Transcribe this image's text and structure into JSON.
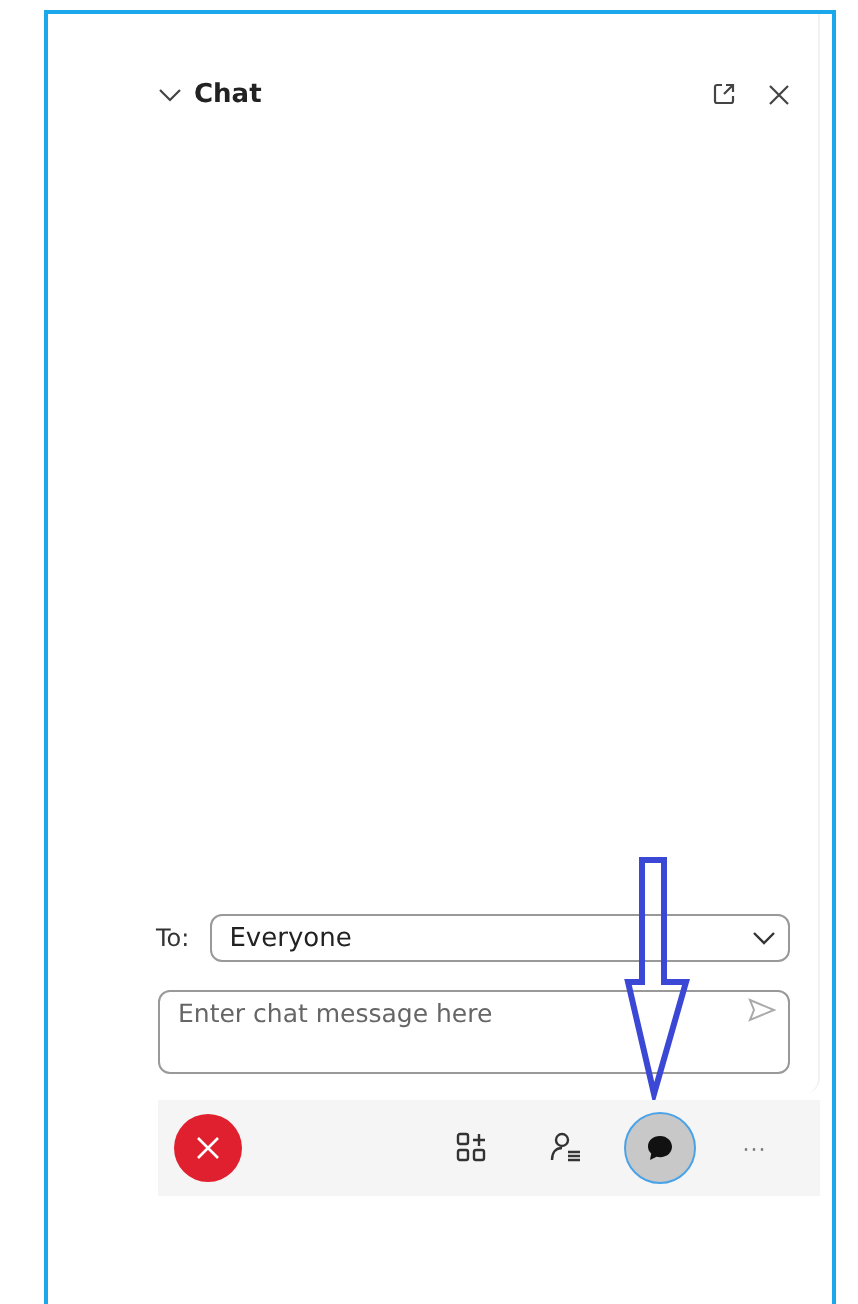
{
  "chat_panel": {
    "title": "Chat",
    "expanded": true
  },
  "recipient": {
    "label": "To:",
    "value": "Everyone"
  },
  "message": {
    "placeholder": "Enter chat message here"
  },
  "toolbar": [
    {
      "kind": "leave",
      "selected": false
    },
    {
      "kind": "apps",
      "selected": false
    },
    {
      "kind": "participants",
      "selected": false
    },
    {
      "kind": "chat",
      "selected": true
    },
    {
      "kind": "more",
      "selected": false,
      "label": "···"
    }
  ],
  "annotation": {
    "kind": "arrow-down"
  }
}
